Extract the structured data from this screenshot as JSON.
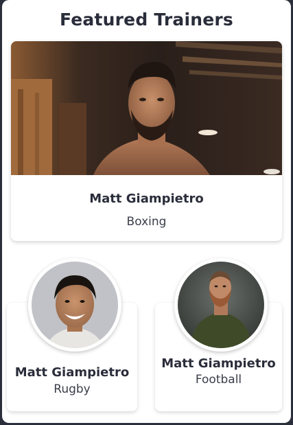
{
  "section": {
    "title": "Featured Trainers"
  },
  "trainers": [
    {
      "name": "Matt Giampietro",
      "sport": "Boxing",
      "photo": "trainer-photo-boxing"
    },
    {
      "name": "Matt Giampietro",
      "sport": "Rugby",
      "photo": "trainer-avatar-rugby"
    },
    {
      "name": "Matt Giampietro",
      "sport": "Football",
      "photo": "trainer-avatar-football"
    }
  ],
  "colors": {
    "page_background": "#2b2e3b",
    "card_background": "#ffffff",
    "text_primary": "#2a2d3a"
  }
}
